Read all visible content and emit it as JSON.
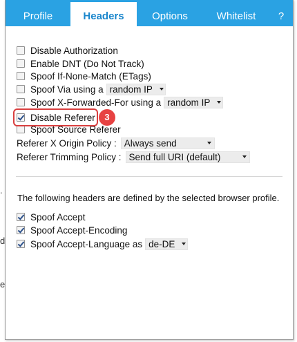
{
  "tabs": [
    {
      "label": "Profile",
      "active": false
    },
    {
      "label": "Headers",
      "active": true
    },
    {
      "label": "Options",
      "active": false
    },
    {
      "label": "Whitelist",
      "active": false
    },
    {
      "label": "?",
      "active": false
    }
  ],
  "headers": {
    "disable_authorization": {
      "label": "Disable Authorization",
      "checked": false
    },
    "enable_dnt": {
      "label": "Enable DNT (Do Not Track)",
      "checked": false
    },
    "spoof_if_none_match": {
      "label": "Spoof If-None-Match (ETags)",
      "checked": false
    },
    "spoof_via": {
      "label": "Spoof Via using a",
      "checked": false,
      "select_value": "random IP"
    },
    "spoof_x_forwarded_for": {
      "label": "Spoof X-Forwarded-For using a",
      "checked": false,
      "select_value": "random IP"
    },
    "disable_referer": {
      "label": "Disable Referer",
      "checked": true
    },
    "spoof_source_referer": {
      "label": "Spoof Source Referer",
      "checked": false
    },
    "referer_x_origin_policy": {
      "label": "Referer X Origin Policy :",
      "select_value": "Always send"
    },
    "referer_trimming_policy": {
      "label": "Referer Trimming Policy :",
      "select_value": "Send full URI (default)"
    }
  },
  "callout": {
    "number": "3"
  },
  "profile_info": "The following headers are defined by the selected browser profile.",
  "profile_headers": {
    "spoof_accept": {
      "label": "Spoof Accept",
      "checked": true
    },
    "spoof_accept_encoding": {
      "label": "Spoof Accept-Encoding",
      "checked": true
    },
    "spoof_accept_language": {
      "label": "Spoof Accept-Language as",
      "checked": true,
      "select_value": "de-DE"
    }
  },
  "colors": {
    "tab_bar": "#2aa2e3",
    "active_tab_text": "#1a86cc",
    "callout": "#e74242"
  }
}
